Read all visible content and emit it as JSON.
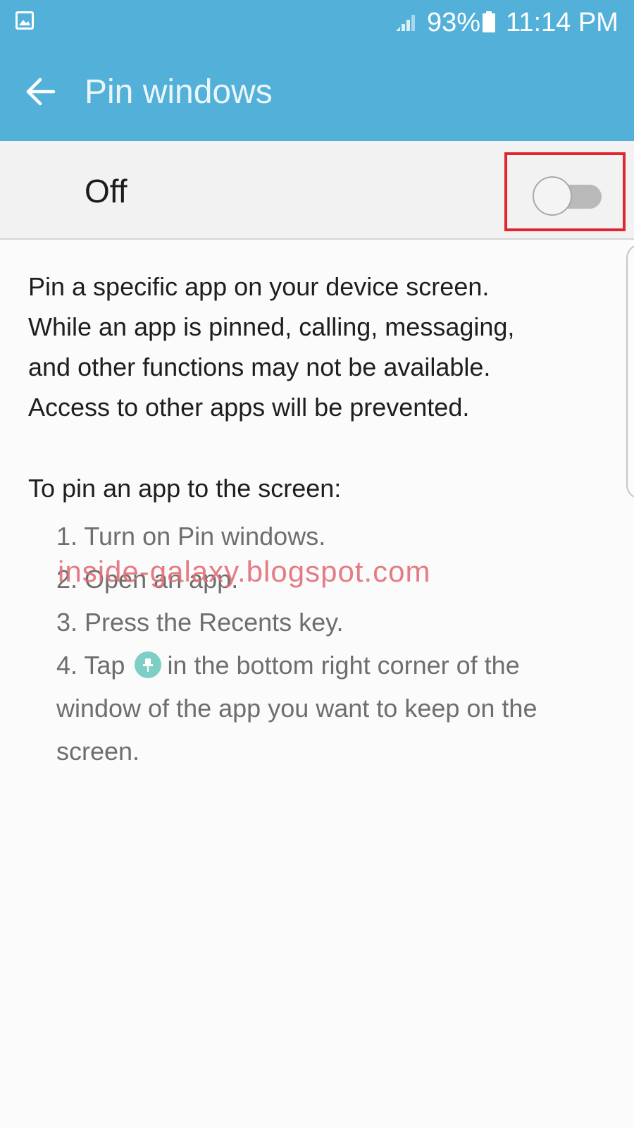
{
  "status_bar": {
    "battery_percent": "93%",
    "time": "11:14 PM",
    "icons": [
      "gallery-icon",
      "signal-icon",
      "battery-icon"
    ]
  },
  "app_bar": {
    "title": "Pin windows",
    "back_icon": "arrow-left-icon"
  },
  "switch_bar": {
    "label": "Off",
    "toggle_state": "off"
  },
  "content": {
    "description_lines": [
      "Pin a specific app on your device screen.",
      "While an app is pinned, calling, messaging,",
      "and other functions may not be available.",
      "Access to other apps will be prevented."
    ],
    "instructions_heading": "To pin an app to the screen:",
    "steps": {
      "step1": "1. Turn on Pin windows.",
      "step2": "2. Open an app.",
      "step3": "3. Press the Recents key.",
      "step4_prefix": "4. Tap",
      "step4_icon": "pin-icon",
      "step4_suffix": "in the bottom right corner of the",
      "step4_line2": "window of the app you want to keep on the",
      "step4_line3": "screen."
    }
  },
  "watermark": "inside-galaxy.blogspot.com",
  "colors": {
    "header": "#53b0d8",
    "switch_bar_bg": "#f2f2f3",
    "highlight_box": "#e0262e",
    "pin_icon": "#7dcfc6",
    "watermark": "#e26e76"
  }
}
